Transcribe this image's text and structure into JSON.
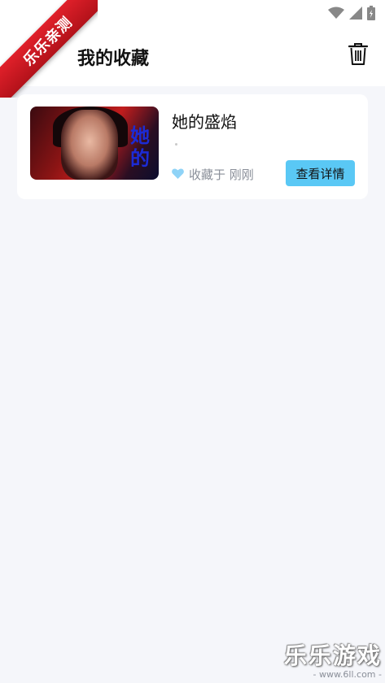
{
  "header": {
    "title": "我的收藏"
  },
  "watermarks": {
    "corner_ribbon": "乐乐亲测",
    "bottom_main": "乐乐游戏",
    "bottom_sub": "- www.6ll.com -"
  },
  "favorites": [
    {
      "title": "她的盛焰",
      "poster_text": "她的",
      "fav_time": "收藏于 刚刚",
      "detail_label": "查看详情"
    }
  ],
  "icons": {
    "back": "arrow-left-icon",
    "trash": "trash-icon",
    "heart": "heart-icon",
    "wifi": "wifi-icon",
    "signal": "signal-icon",
    "battery": "battery-icon"
  },
  "colors": {
    "accent": "#5ac8f5",
    "heart": "#8fd3f7",
    "background": "#f5f6fa",
    "ribbon": "#d11a22"
  }
}
